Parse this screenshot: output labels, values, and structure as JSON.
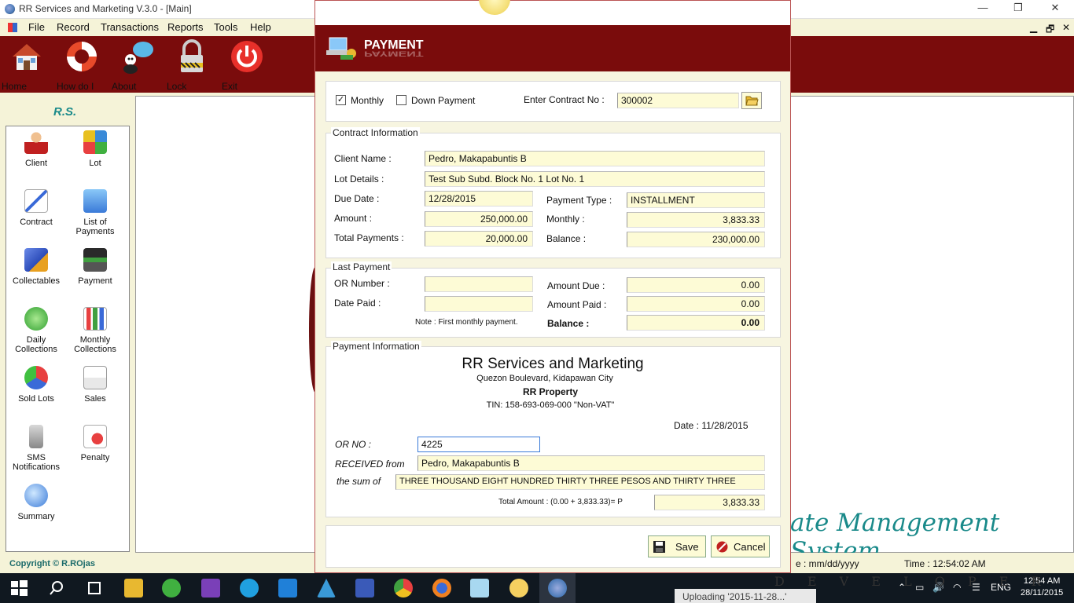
{
  "window": {
    "title": "RR Services and Marketing V.3.0 - [Main]",
    "minimize": "—",
    "restore": "❐",
    "close": "✕"
  },
  "menu": [
    "File",
    "Record",
    "Transactions",
    "Reports",
    "Tools",
    "Help"
  ],
  "mdi_controls": [
    "▁",
    "🗗",
    "✕"
  ],
  "toolbar": [
    {
      "label": "Home",
      "icon": "house-icon"
    },
    {
      "label": "How do I",
      "icon": "lifebuoy-icon"
    },
    {
      "label": "About",
      "icon": "chat-person-icon"
    },
    {
      "label": "Lock",
      "icon": "padlock-icon"
    },
    {
      "label": "Exit",
      "icon": "power-icon"
    }
  ],
  "sidebar": {
    "heading": "R.S.",
    "items": [
      {
        "label": "Client"
      },
      {
        "label": "Lot"
      },
      {
        "label": "Contract"
      },
      {
        "label": "List of Payments"
      },
      {
        "label": "Collectables"
      },
      {
        "label": "Payment"
      },
      {
        "label": "Daily Collections"
      },
      {
        "label": "Monthly Collections"
      },
      {
        "label": "Sold Lots"
      },
      {
        "label": "Sales"
      },
      {
        "label": "SMS Notifications"
      },
      {
        "label": "Penalty"
      },
      {
        "label": "Summary"
      }
    ]
  },
  "background_text": "ate Management System",
  "status": {
    "copyright": "Copyright © R.ROjas",
    "date": "e :   mm/dd/yyyy",
    "time": "Time :  12:54:02 AM"
  },
  "taskbar": {
    "lang": "ENG",
    "clock_time": "12:54 AM",
    "clock_date": "28/11/2015",
    "upload_toast": "Uploading '2015-11-28...'",
    "dev_text": "D E V E L O P E R S"
  },
  "dialog": {
    "title": "PAYMENT",
    "monthly_label": "Monthly",
    "monthly_checked": true,
    "down_payment_label": "Down Payment",
    "down_payment_checked": false,
    "contract_no_label": "Enter Contract No :",
    "contract_no": "300002",
    "contract_info": {
      "legend": "Contract Information",
      "client_name_label": "Client Name :",
      "client_name": "Pedro, Makapabuntis B",
      "lot_details_label": "Lot Details :",
      "lot_details": "Test Sub Subd.  Block No. 1 Lot No. 1",
      "due_date_label": "Due Date :",
      "due_date": "12/28/2015",
      "payment_type_label": "Payment Type :",
      "payment_type": "INSTALLMENT",
      "amount_label": "Amount :",
      "amount": "250,000.00",
      "monthly_label": "Monthly :",
      "monthly": "3,833.33",
      "total_payments_label": "Total Payments :",
      "total_payments": "20,000.00",
      "balance_label": "Balance :",
      "balance": "230,000.00"
    },
    "last_payment": {
      "legend": "Last Payment",
      "or_number_label": "OR Number :",
      "or_number": "",
      "date_paid_label": "Date Paid :",
      "date_paid": "",
      "amount_due_label": "Amount Due :",
      "amount_due": "0.00",
      "amount_paid_label": "Amount Paid :",
      "amount_paid": "0.00",
      "note": "Note : First monthly payment.",
      "balance_label": "Balance :",
      "balance": "0.00"
    },
    "payment_info": {
      "legend": "Payment Information",
      "company": "RR Services and Marketing",
      "address": "Quezon Boulevard, Kidapawan City",
      "property": "RR Property",
      "tin": "TIN: 158-693-069-000 \"Non-VAT\"",
      "date_label": "Date :  11/28/2015",
      "or_no_label": "OR NO :",
      "or_no": "4225",
      "received_from_label": "RECEIVED from",
      "received_from": "Pedro, Makapabuntis B",
      "sum_of_label": "the sum of",
      "sum_of": "THREE THOUSAND EIGHT HUNDRED THIRTY THREE PESOS AND THIRTY THREE",
      "total_amount_label": "Total Amount : (0.00 + 3,833.33)=  P",
      "total_amount": "3,833.33"
    },
    "save_label": "Save",
    "cancel_label": "Cancel"
  },
  "colors": {
    "brand_maroon": "#7a0c0c",
    "field_bg": "#fdfbd6",
    "teal": "#1a8a8a"
  }
}
